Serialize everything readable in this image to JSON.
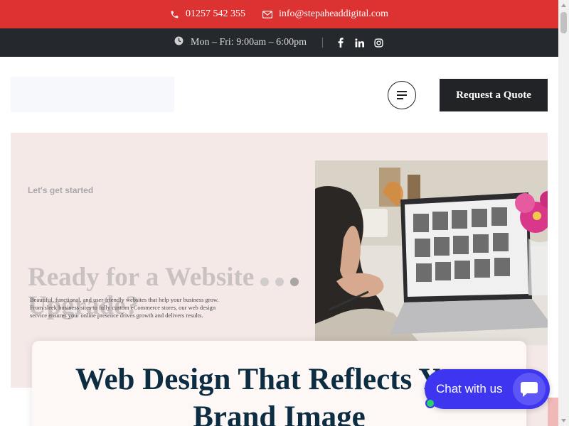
{
  "topbar": {
    "phone": "01257 542 355",
    "email": "info@stepaheaddigital.com",
    "phone_icon": "phone-icon",
    "email_icon": "envelope-icon",
    "background": "#dc3232"
  },
  "hoursbar": {
    "hours": "Mon – Fri: 9:00am – 6:00pm",
    "clock_icon": "clock-icon",
    "social": [
      "facebook-icon",
      "linkedin-icon",
      "instagram-icon"
    ],
    "background": "#25282c"
  },
  "header": {
    "menu_icon": "menu-icon",
    "quote_label": "Request a Quote"
  },
  "hero": {
    "kicker": "Let's get started",
    "title": "Ready for a Website Upgrade?",
    "description": "Beautiful, functional, and user-friendly websites that help your business grow. From sleek business sites to fully custom eCommerce stores, our web design service ensures your online presence drives growth and delivers results.",
    "slides": 3,
    "active_slide": 3
  },
  "card": {
    "title": "Web Design That Reflects Your\nBrand Image"
  },
  "chat": {
    "label": "Chat with us",
    "icon": "chat-bubble-icon",
    "accent": "#3d35f0"
  }
}
